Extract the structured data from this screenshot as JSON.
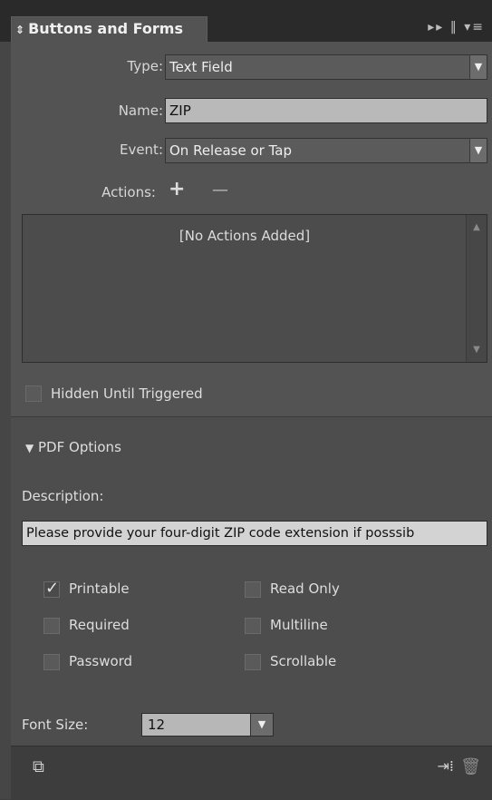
{
  "header": {
    "title": "Buttons and Forms",
    "collapse_icon": "double-arrow-icon",
    "menu_icon": "panel-menu-icon",
    "forward_icon": "forward-icon"
  },
  "fields": {
    "type_label": "Type:",
    "type_value": "Text Field",
    "name_label": "Name:",
    "name_value": "ZIP",
    "event_label": "Event:",
    "event_value": "On Release or Tap",
    "actions_label": "Actions:",
    "add_symbol": "+",
    "remove_symbol": "—",
    "no_actions": "[No Actions Added]"
  },
  "hidden_until_triggered": {
    "label": "Hidden Until Triggered",
    "checked": false
  },
  "pdf_options": {
    "title": "PDF Options",
    "description_label": "Description:",
    "description_value": "Please provide your four-digit ZIP code extension if posssib",
    "checkboxes": [
      {
        "label": "Printable",
        "checked": true
      },
      {
        "label": "Read Only",
        "checked": false
      },
      {
        "label": "Required",
        "checked": false
      },
      {
        "label": "Multiline",
        "checked": false
      },
      {
        "label": "Password",
        "checked": false
      },
      {
        "label": "Scrollable",
        "checked": false
      }
    ],
    "font_size_label": "Font Size:",
    "font_size_value": "12"
  },
  "colors": {
    "panel_bg": "#535353",
    "header_bg": "#2a2a2a",
    "field_bg": "#b9b9b9"
  }
}
